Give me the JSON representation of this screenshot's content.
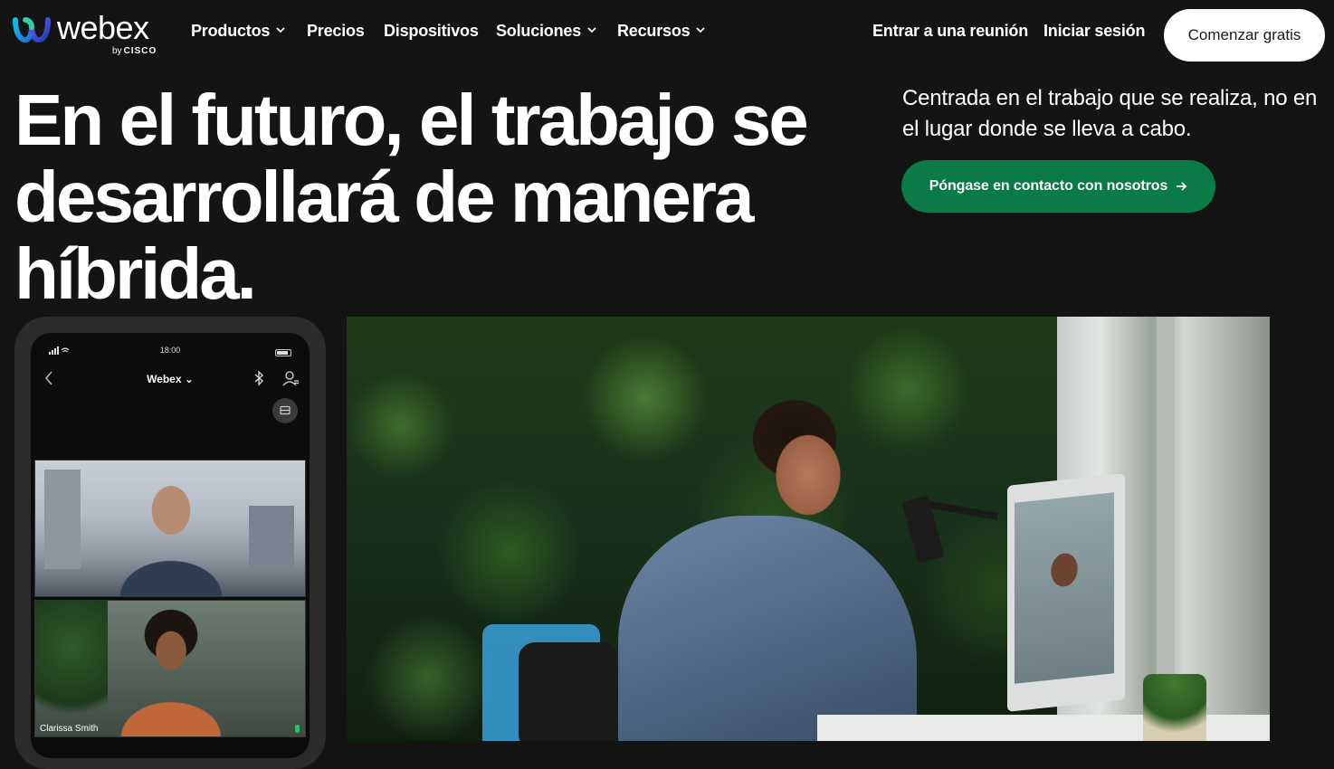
{
  "brand": {
    "name": "webex",
    "by": "by",
    "parent": "CISCO"
  },
  "nav": {
    "items": [
      {
        "label": "Productos",
        "has_dropdown": true
      },
      {
        "label": "Precios",
        "has_dropdown": false
      },
      {
        "label": "Dispositivos",
        "has_dropdown": false
      },
      {
        "label": "Soluciones",
        "has_dropdown": true
      },
      {
        "label": "Recursos",
        "has_dropdown": true
      }
    ],
    "join_meeting": "Entrar a una reunión",
    "sign_in": "Iniciar sesión",
    "start_free": "Comenzar gratis"
  },
  "hero": {
    "headline": "En el futuro, el trabajo se desarrollará de manera híbrida.",
    "subhead": "Centrada en el trabajo que se realiza, no en el lugar donde se lleva a cabo.",
    "cta": "Póngase en contacto con nosotros",
    "cta_icon": "arrow-right-icon",
    "cta_color": "#0a7a47"
  },
  "phone": {
    "time": "18:00",
    "app_title": "Webex",
    "participants": [
      {
        "name": ""
      },
      {
        "name": "Clarissa Smith"
      }
    ]
  },
  "colors": {
    "background": "#141414",
    "text": "#ffffff",
    "button_light": "#ffffff"
  }
}
